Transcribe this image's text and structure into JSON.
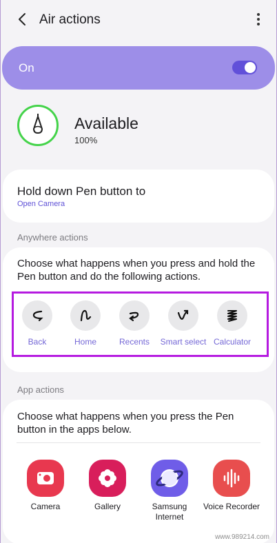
{
  "header": {
    "title": "Air actions",
    "back_icon": "back-arrow-icon",
    "more_icon": "more-vert-icon"
  },
  "master_switch": {
    "label": "On",
    "state": true,
    "accent": "#9d8ee8"
  },
  "pen_status": {
    "title": "Available",
    "battery": "100%",
    "ring_color": "#44d34a"
  },
  "hold_button": {
    "title": "Hold down Pen button to",
    "value": "Open Camera"
  },
  "anywhere": {
    "section_label": "Anywhere actions",
    "description": "Choose what happens when you press and hold the Pen button and do the following actions.",
    "items": [
      {
        "label": "Back",
        "icon": "gesture-back-icon"
      },
      {
        "label": "Home",
        "icon": "gesture-home-icon"
      },
      {
        "label": "Recents",
        "icon": "gesture-recents-icon"
      },
      {
        "label": "Smart select",
        "icon": "gesture-smart-select-icon"
      },
      {
        "label": "Calculator",
        "icon": "gesture-calculator-icon"
      }
    ]
  },
  "app_actions": {
    "section_label": "App actions",
    "description": "Choose what happens when you press the Pen button in the apps below.",
    "apps": [
      {
        "label": "Camera",
        "icon": "camera-app-icon",
        "color": "#e8384f"
      },
      {
        "label": "Gallery",
        "icon": "gallery-app-icon",
        "color": "#d81e5b"
      },
      {
        "label": "Samsung Internet",
        "icon": "samsung-internet-icon",
        "color": "#6f5de8"
      },
      {
        "label": "Voice Recorder",
        "icon": "voice-recorder-icon",
        "color": "#e84e4e"
      }
    ]
  },
  "watermark": "www.989214.com"
}
